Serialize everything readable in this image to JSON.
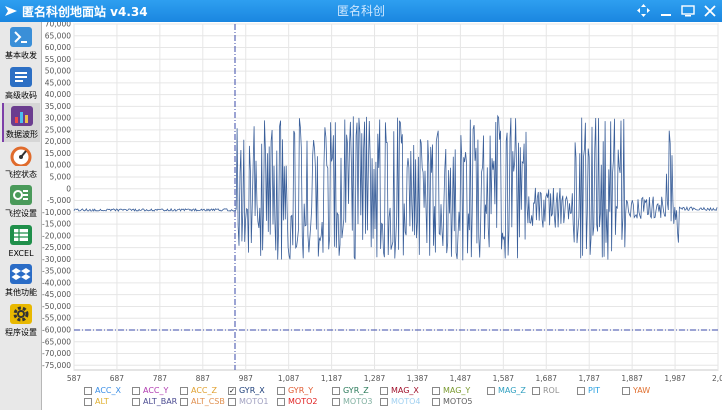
{
  "titlebar": {
    "app_title": "匿名科创地面站 v4.34",
    "center_title": "匿名科创"
  },
  "sidebar": {
    "items": [
      {
        "label": "基本收发",
        "icon": "terminal-icon",
        "color": "#3a8fd8"
      },
      {
        "label": "高级收码",
        "icon": "document-lines-icon",
        "color": "#2c6fc4"
      },
      {
        "label": "数据波形",
        "icon": "bar-chart-icon",
        "color": "#6b3d8f"
      },
      {
        "label": "飞控状态",
        "icon": "gauge-icon",
        "color": "#e06b2c"
      },
      {
        "label": "飞控设置",
        "icon": "settings-panel-icon",
        "color": "#4a9a5a"
      },
      {
        "label": "EXCEL",
        "icon": "spreadsheet-icon",
        "color": "#1f8f4a"
      },
      {
        "label": "其他功能",
        "icon": "dropbox-icon",
        "color": "#2a6cc6"
      },
      {
        "label": "程序设置",
        "icon": "gear-icon",
        "color": "#e8b800"
      }
    ],
    "active_index": 2
  },
  "chart_data": {
    "type": "line",
    "title": "",
    "xlabel": "",
    "ylabel": "",
    "xlim": [
      587,
      2087
    ],
    "ylim": [
      -77000,
      70000
    ],
    "x_ticks": [
      "587",
      "687",
      "787",
      "887",
      "987",
      "1,087",
      "1,187",
      "1,287",
      "1,387",
      "1,487",
      "1,587",
      "1,687",
      "1,787",
      "1,887",
      "1,987",
      "2,0"
    ],
    "y_ticks": [
      "70,000",
      "65,000",
      "60,000",
      "55,000",
      "50,000",
      "45,000",
      "40,000",
      "35,000",
      "30,000",
      "25,000",
      "20,000",
      "15,000",
      "10,000",
      "5,000",
      "0",
      "-5,000",
      "-10,000",
      "-15,000",
      "-20,000",
      "-25,000",
      "-30,000",
      "-35,000",
      "-40,000",
      "-45,000",
      "-50,000",
      "-55,000",
      "-60,000",
      "-65,000",
      "-70,000",
      "-75,000"
    ],
    "grid": true,
    "cursor_x": 962,
    "cursor_y": -60000,
    "series": [
      {
        "name": "GYR_X",
        "color": "#3a5f9a",
        "segments": [
          {
            "x_start": 587,
            "x_end": 967,
            "mean": -9000,
            "amplitude": 500
          },
          {
            "x_start": 967,
            "x_end": 1642,
            "mean": 0,
            "amplitude": 31000
          },
          {
            "x_start": 1642,
            "x_end": 1752,
            "mean": -8000,
            "amplitude": 9000
          },
          {
            "x_start": 1752,
            "x_end": 1872,
            "mean": 0,
            "amplitude": 31000
          },
          {
            "x_start": 1872,
            "x_end": 1967,
            "mean": -8000,
            "amplitude": 5000
          },
          {
            "x_start": 1967,
            "x_end": 1997,
            "mean": 0,
            "amplitude": 26000
          },
          {
            "x_start": 1997,
            "x_end": 2087,
            "mean": -8500,
            "amplitude": 700
          }
        ]
      }
    ]
  },
  "legend": {
    "items": [
      {
        "label": "ACC_X",
        "color": "#3a8ee6",
        "checked": false
      },
      {
        "label": "ACC_Y",
        "color": "#b03ab0",
        "checked": false
      },
      {
        "label": "ACC_Z",
        "color": "#e0a030",
        "checked": false
      },
      {
        "label": "GYR_X",
        "color": "#1e3f7a",
        "checked": true
      },
      {
        "label": "GYR_Y",
        "color": "#e05a30",
        "checked": false
      },
      {
        "label": "GYR_Z",
        "color": "#2a7a5a",
        "checked": false
      },
      {
        "label": "MAG_X",
        "color": "#a0102a",
        "checked": false
      },
      {
        "label": "MAG_Y",
        "color": "#7a9a30",
        "checked": false
      },
      {
        "label": "MAG_Z",
        "color": "#30a0c0",
        "checked": false
      },
      {
        "label": "ROL",
        "color": "#909090",
        "checked": false
      },
      {
        "label": "PIT",
        "color": "#2aa0e0",
        "checked": false
      },
      {
        "label": "YAW",
        "color": "#e07030",
        "checked": false
      },
      {
        "label": "ALT",
        "color": "#e0b030",
        "checked": false
      },
      {
        "label": "ALT_BAR",
        "color": "#4a4a90",
        "checked": false
      },
      {
        "label": "ALT_CSB",
        "color": "#e09050",
        "checked": false
      },
      {
        "label": "MOTO1",
        "color": "#a0a0c0",
        "checked": false
      },
      {
        "label": "MOTO2",
        "color": "#e02020",
        "checked": false
      },
      {
        "label": "MOTO3",
        "color": "#80b0a0",
        "checked": false
      },
      {
        "label": "MOTO4",
        "color": "#a0d0f0",
        "checked": false
      },
      {
        "label": "MOTO5",
        "color": "#606060",
        "checked": false
      }
    ]
  }
}
